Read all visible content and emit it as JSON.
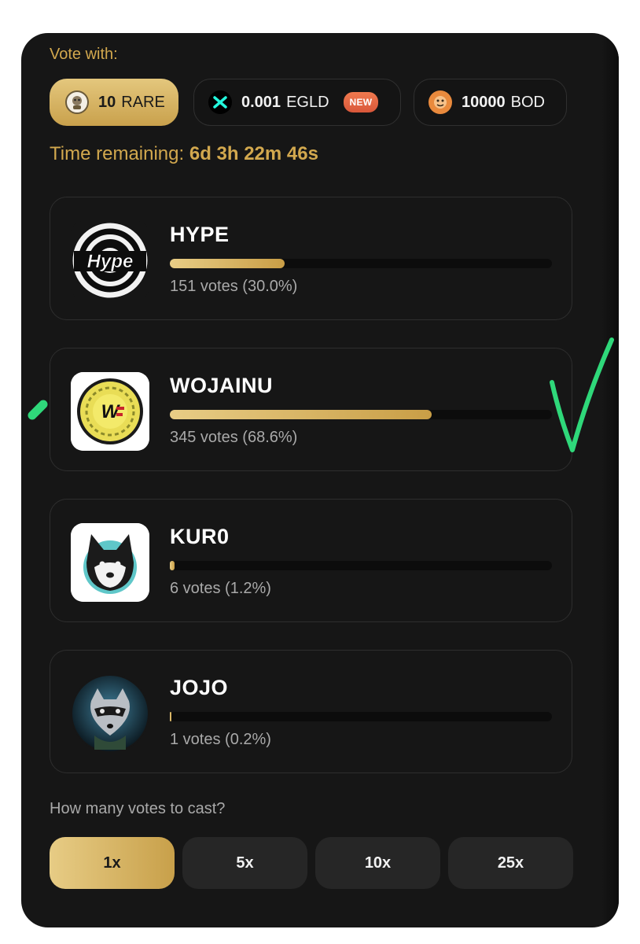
{
  "header": {
    "vote_with_label": "Vote with:"
  },
  "tokens": [
    {
      "amount": "10",
      "symbol": "RARE",
      "icon": "rare-token-icon",
      "selected": true
    },
    {
      "amount": "0.001",
      "symbol": "EGLD",
      "icon": "egld-token-icon",
      "badge": "NEW",
      "selected": false
    },
    {
      "amount": "10000",
      "symbol": "BOD",
      "icon": "bod-token-icon",
      "selected": false
    }
  ],
  "timer": {
    "label": "Time remaining:",
    "value": "6d 3h 22m 46s"
  },
  "candidates": [
    {
      "name": "HYPE",
      "votes_text": "151 votes (30.0%)",
      "share": 0.3,
      "logo": "hype-logo"
    },
    {
      "name": "WOJAINU",
      "votes_text": "345 votes (68.6%)",
      "share": 0.686,
      "logo": "wojainu-logo"
    },
    {
      "name": "KUR0",
      "votes_text": "6 votes (1.2%)",
      "share": 0.012,
      "logo": "kuro-logo"
    },
    {
      "name": "JOJO",
      "votes_text": "1 votes (0.2%)",
      "share": 0.002,
      "logo": "jojo-logo"
    }
  ],
  "cast": {
    "label": "How many votes to cast?",
    "options": [
      "1x",
      "5x",
      "10x",
      "25x"
    ],
    "selected": "1x"
  },
  "colors": {
    "accent": "#d2a84e",
    "panel": "#161616",
    "annotation": "#2fd87a"
  }
}
